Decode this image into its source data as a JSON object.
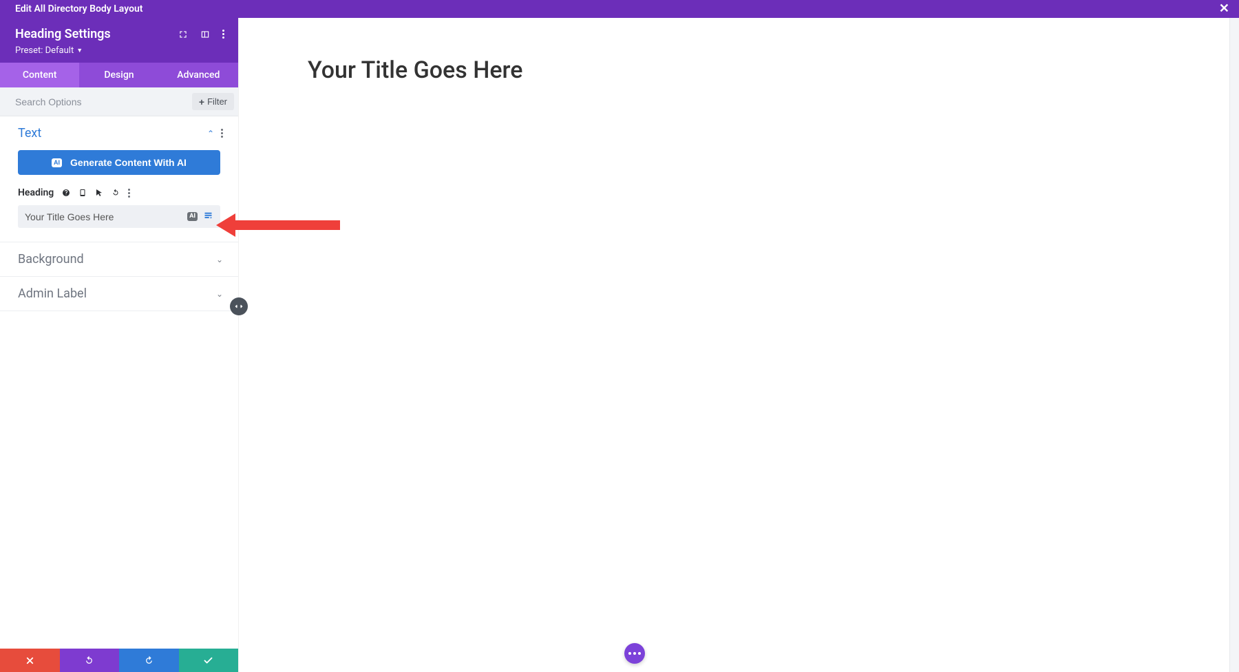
{
  "topbar": {
    "title": "Edit All Directory Body Layout"
  },
  "panel": {
    "title": "Heading Settings",
    "preset_label": "Preset: Default",
    "tabs": {
      "content": "Content",
      "design": "Design",
      "advanced": "Advanced"
    }
  },
  "search": {
    "placeholder": "Search Options",
    "filter_label": "Filter"
  },
  "text_section": {
    "title": "Text",
    "ai_button": "Generate Content With AI",
    "field_label": "Heading",
    "field_value": "Your Title Goes Here",
    "ai_badge": "AI"
  },
  "background_section": {
    "title": "Background"
  },
  "adminlabel_section": {
    "title": "Admin Label"
  },
  "preview": {
    "heading": "Your Title Goes Here"
  }
}
